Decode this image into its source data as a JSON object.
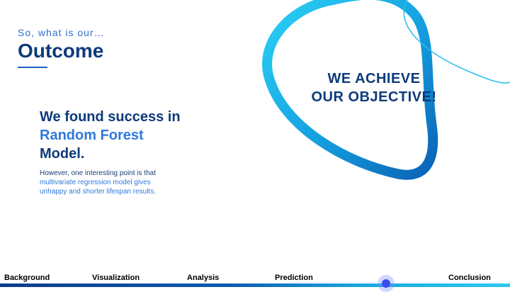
{
  "slide": {
    "kicker": "So, what is our…",
    "title": "Outcome",
    "headline_line1": "We found success in",
    "headline_accent": "Random Forest",
    "headline_line3": "Model.",
    "body_prefix": "However, one interesting point is that",
    "body_accent": "multivariate regression model gives",
    "body_suffix": "unhappy and shorter lifespan results.",
    "callout_line1": "WE ACHIEVE",
    "callout_line2": "OUR OBJECTIVE!"
  },
  "nav": {
    "items": [
      "Background",
      "Visualization",
      "Analysis",
      "Prediction",
      "Conclusion"
    ],
    "active_marker_after": "Prediction"
  },
  "colors": {
    "navy": "#0d3a7a",
    "accent_blue": "#2f79dc",
    "cyan": "#1fc3f0",
    "indicator": "#3b4cf0"
  }
}
